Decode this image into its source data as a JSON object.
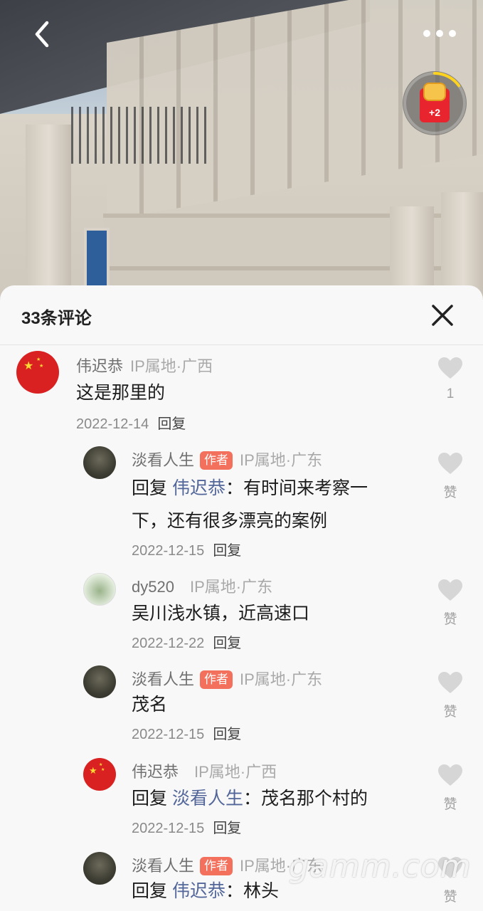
{
  "top_bar": {
    "back_icon": "chevron-left-icon",
    "more_icon": "more-dots-icon",
    "red_packet": {
      "icon": "red-packet-icon",
      "label": "+2",
      "progress_fraction": 0.15
    }
  },
  "comments_panel": {
    "title": "33条评论",
    "close_icon": "close-icon",
    "reply_label": "回复",
    "author_badge": "作者",
    "comments": [
      {
        "user": "伟迟恭",
        "ip": "IP属地·广西",
        "avatar": "china-flag-avatar",
        "text": "这是那里的",
        "date": "2022-12-14",
        "like_label": "1"
      },
      {
        "user": "淡看人生",
        "is_author": true,
        "ip": "IP属地·广东",
        "avatar": "tree-avatar",
        "reply_prefix": "回复",
        "mention": "伟迟恭",
        "text_line1": "：有时间来考察一",
        "text_line2": "下，还有很多漂亮的案例",
        "date": "2022-12-15",
        "like_label": "赞"
      },
      {
        "user": "dy520",
        "ip": "IP属地·广东",
        "avatar": "kids-avatar",
        "text": "吴川浅水镇，近高速口",
        "date": "2022-12-22",
        "like_label": "赞"
      },
      {
        "user": "淡看人生",
        "is_author": true,
        "ip": "IP属地·广东",
        "avatar": "tree-avatar",
        "text": "茂名",
        "date": "2022-12-15",
        "like_label": "赞"
      },
      {
        "user": "伟迟恭",
        "ip": "IP属地·广西",
        "avatar": "china-flag-avatar",
        "reply_prefix": "回复",
        "mention": "淡看人生",
        "text_rest": "：茂名那个村的",
        "date": "2022-12-15",
        "like_label": "赞"
      },
      {
        "user": "淡看人生",
        "is_author": true,
        "ip": "IP属地·广东",
        "avatar": "tree-avatar",
        "reply_prefix": "回复",
        "mention": "伟迟恭",
        "text_rest": "：林头",
        "like_label": "赞"
      }
    ]
  },
  "watermark": "gamm.com",
  "colors": {
    "sheet_bg": "#f8f8f8",
    "mention": "#53669a",
    "author_badge": "#f3705d",
    "heart": "#d6d6d6",
    "red_packet": "#e8252e"
  }
}
